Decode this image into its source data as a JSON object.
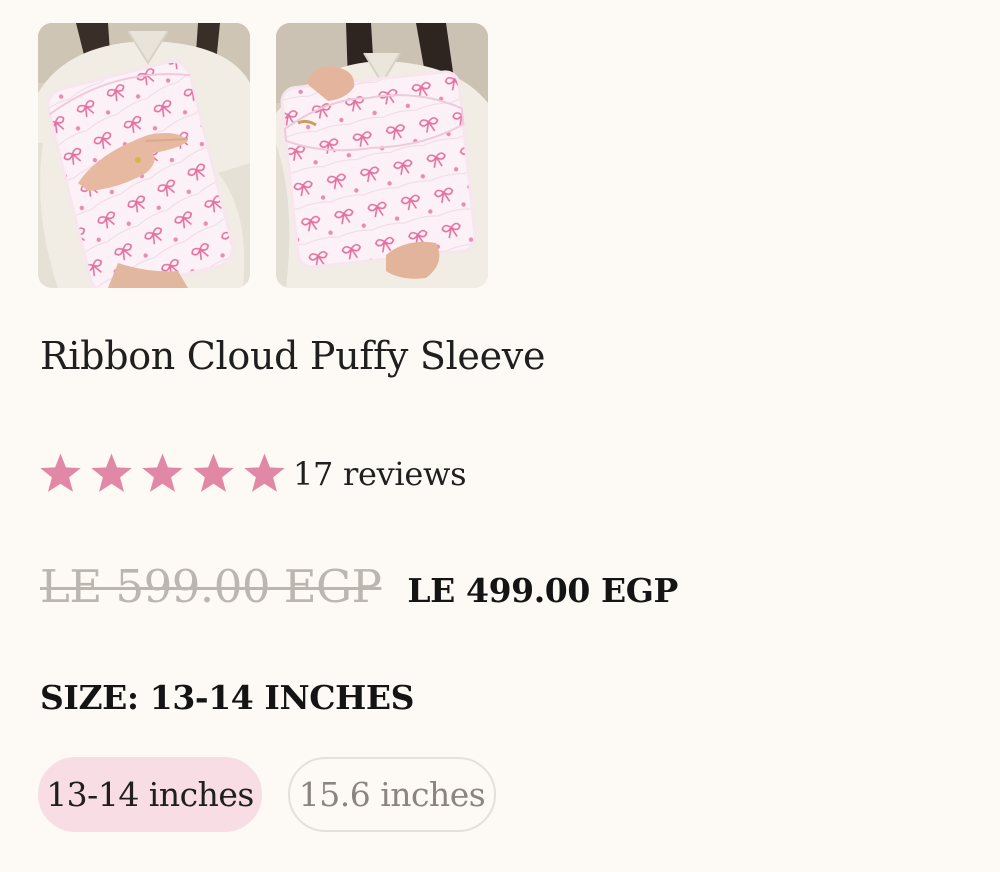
{
  "product": {
    "images": [
      {
        "alt": "product-photo-1",
        "shape": "hugged sleeve"
      },
      {
        "alt": "product-photo-2",
        "shape": "held sleeve"
      }
    ],
    "title": "Ribbon Cloud Puffy Sleeve",
    "rating": {
      "stars": 5,
      "max_stars": 5,
      "reviews_text": "17 reviews",
      "star_color": "#e088a6"
    },
    "price": {
      "compare_at": "LE 599.00 EGP",
      "current": "LE 499.00 EGP"
    },
    "size": {
      "label": "SIZE: 13-14 INCHES",
      "options": [
        {
          "label": "13-14 inches",
          "selected": true
        },
        {
          "label": "15.6 inches",
          "selected": false
        }
      ]
    }
  },
  "colors": {
    "background": "#fdf9f4",
    "selected_pill": "#f9dde4",
    "ribbon_pink": "#e46fa0",
    "old_price_gray": "#bbb6b0"
  }
}
